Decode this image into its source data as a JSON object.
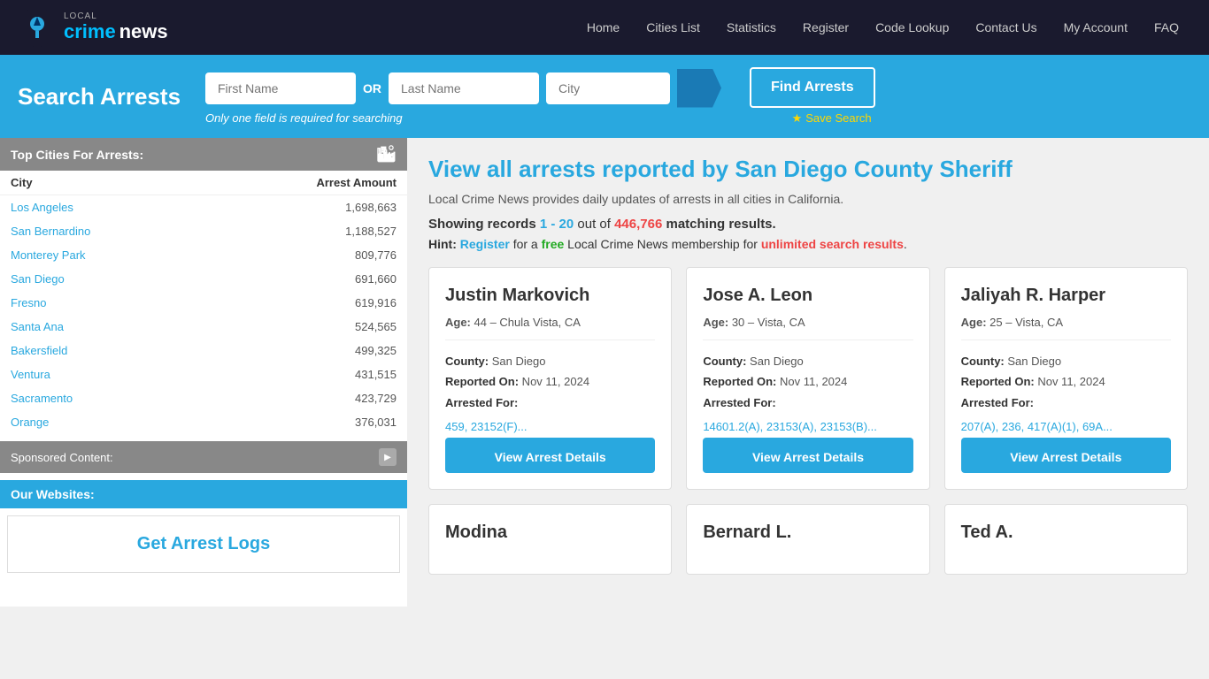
{
  "nav": {
    "links": [
      "Home",
      "Cities List",
      "Statistics",
      "Register",
      "Code Lookup",
      "Contact Us",
      "My Account",
      "FAQ"
    ]
  },
  "logo": {
    "local": "LOCAL",
    "crime": "crime",
    "news": " news"
  },
  "searchBar": {
    "title": "Search Arrests",
    "firstNamePlaceholder": "First Name",
    "lastNamePlaceholder": "Last Name",
    "cityPlaceholder": "City",
    "orLabel": "OR",
    "hint": "Only one field is required for searching",
    "findButton": "Find Arrests",
    "saveSearch": "Save Search"
  },
  "sidebar": {
    "topCitiesHeader": "Top Cities For Arrests:",
    "columns": [
      "City",
      "Arrest Amount"
    ],
    "cities": [
      {
        "name": "Los Angeles",
        "amount": "1,698,663"
      },
      {
        "name": "San Bernardino",
        "amount": "1,188,527"
      },
      {
        "name": "Monterey Park",
        "amount": "809,776"
      },
      {
        "name": "San Diego",
        "amount": "691,660"
      },
      {
        "name": "Fresno",
        "amount": "619,916"
      },
      {
        "name": "Santa Ana",
        "amount": "524,565"
      },
      {
        "name": "Bakersfield",
        "amount": "499,325"
      },
      {
        "name": "Ventura",
        "amount": "431,515"
      },
      {
        "name": "Sacramento",
        "amount": "423,729"
      },
      {
        "name": "Orange",
        "amount": "376,031"
      }
    ],
    "sponsoredLabel": "Sponsored Content:",
    "ourWebsitesLabel": "Our Websites:",
    "getArrestLogsTitle": "Get Arrest Logs"
  },
  "content": {
    "pageTitle": "View all arrests reported by San Diego County Sheriff",
    "subtitle": "Local Crime News provides daily updates of arrests in all cities in California.",
    "showingStart": "Showing records ",
    "range": "1 - 20",
    "outOf": " out of ",
    "total": "446,766",
    "matchingResults": " matching results.",
    "hintLabel": "Hint:",
    "hintText1": " Register",
    "hintText2": " for a ",
    "hintFree": "free",
    "hintText3": " Local Crime News membership for ",
    "hintUnlimited": "unlimited search results",
    "hintEnd": ".",
    "cards": [
      {
        "name": "Justin Markovich",
        "age": "44",
        "location": "Chula Vista, CA",
        "county": "San Diego",
        "reportedOn": "Nov 11, 2024",
        "charges": "459, 23152(F)..."
      },
      {
        "name": "Jose A. Leon",
        "age": "30",
        "location": "Vista, CA",
        "county": "San Diego",
        "reportedOn": "Nov 11, 2024",
        "charges": "14601.2(A), 23153(A), 23153(B)..."
      },
      {
        "name": "Jaliyah R. Harper",
        "age": "25",
        "location": "Vista, CA",
        "county": "San Diego",
        "reportedOn": "Nov 11, 2024",
        "charges": "207(A), 236, 417(A)(1), 69A..."
      }
    ],
    "cards2": [
      {
        "name": "Modina"
      },
      {
        "name": "Bernard L."
      },
      {
        "name": "Ted A."
      }
    ],
    "viewDetailsLabel": "View Arrest Details"
  }
}
